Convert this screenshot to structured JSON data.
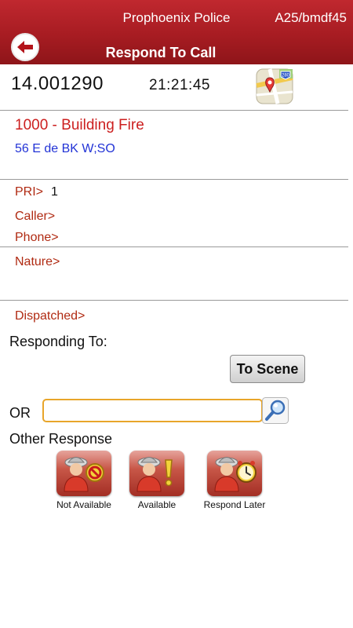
{
  "header": {
    "app_name": "Prophoenix Police",
    "unit": "A25/bmdf45",
    "title": "Respond To Call"
  },
  "call": {
    "number": "14.001290",
    "time": "21:21:45",
    "type": "1000 - Building Fire",
    "address": "56 E de BK W;SO",
    "map_badge": "280"
  },
  "fields": {
    "pri_label": "PRI>",
    "pri_value": "1",
    "caller_label": "Caller>",
    "phone_label": "Phone>",
    "nature_label": "Nature>",
    "dispatched_label": "Dispatched>"
  },
  "responding": {
    "label": "Responding To:",
    "to_scene_label": "To Scene",
    "or_label": "OR",
    "input_value": "",
    "input_placeholder": ""
  },
  "other_response": {
    "label": "Other Response",
    "items": [
      {
        "label": "Not Available",
        "icon": "firefighter-no-icon"
      },
      {
        "label": "Available",
        "icon": "firefighter-available-icon"
      },
      {
        "label": "Respond Later",
        "icon": "firefighter-clock-icon"
      }
    ]
  },
  "colors": {
    "header_red": "#a71c22",
    "label_red": "#b02a12",
    "call_type_red": "#cc1f1f",
    "address_blue": "#2233d6",
    "input_border": "#e8a52a"
  }
}
